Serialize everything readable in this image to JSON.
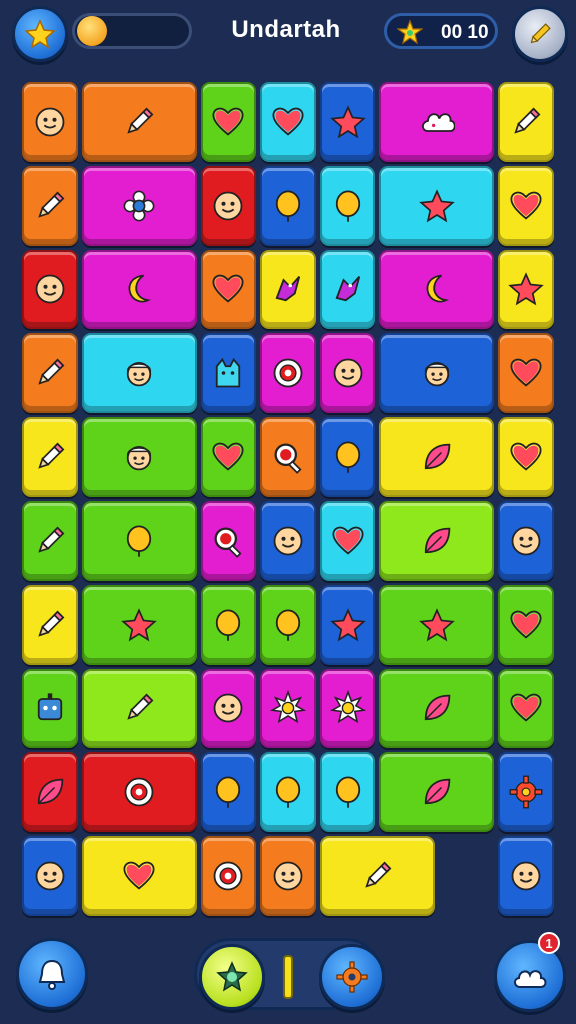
{
  "header": {
    "title": "Undartah",
    "timer": "00 10",
    "progress_fraction": 0.1,
    "left_button_icon": "star-icon",
    "right_button_icon": "pencil-icon",
    "progress_icon": "coin-flower-icon",
    "timer_icon": "star-sparkle-icon"
  },
  "footer": {
    "left_button_icon": "bell-icon",
    "center_left_icon": "star-gem-icon",
    "center_right_icon": "gear-icon",
    "right_button_icon": "cloud-icon",
    "notification_count": "1"
  },
  "colors": {
    "orange": "#f47c1e",
    "cyan": "#2fd6f0",
    "green": "#5fd21a",
    "lime": "#8fe81c",
    "blue": "#1e62d8",
    "magenta": "#e21ed0",
    "yellow": "#f7e61b",
    "red": "#e01c20"
  },
  "board": {
    "rows": 10,
    "tiles": [
      {
        "row": 0,
        "col": 0,
        "span": 1,
        "color": "orange",
        "icon": "face-icon"
      },
      {
        "row": 0,
        "col": 1,
        "span": 2,
        "color": "orange",
        "icon": "pencil-icon"
      },
      {
        "row": 0,
        "col": 3,
        "span": 1,
        "color": "green",
        "icon": "heart-icon"
      },
      {
        "row": 0,
        "col": 4,
        "span": 1,
        "color": "cyan",
        "icon": "heart-icon"
      },
      {
        "row": 0,
        "col": 5,
        "span": 1,
        "color": "blue",
        "icon": "star-icon"
      },
      {
        "row": 0,
        "col": 6,
        "span": 2,
        "color": "magenta",
        "icon": "cloud-icon"
      },
      {
        "row": 0,
        "col": 8,
        "span": 1,
        "color": "yellow",
        "icon": "pencil-icon"
      },
      {
        "row": 1,
        "col": 0,
        "span": 1,
        "color": "orange",
        "icon": "pencil-icon"
      },
      {
        "row": 1,
        "col": 1,
        "span": 2,
        "color": "magenta",
        "icon": "flower-icon"
      },
      {
        "row": 1,
        "col": 3,
        "span": 1,
        "color": "red",
        "icon": "face-icon"
      },
      {
        "row": 1,
        "col": 4,
        "span": 1,
        "color": "blue",
        "icon": "balloon-icon"
      },
      {
        "row": 1,
        "col": 5,
        "span": 1,
        "color": "cyan",
        "icon": "balloon-icon"
      },
      {
        "row": 1,
        "col": 6,
        "span": 2,
        "color": "cyan",
        "icon": "star-icon"
      },
      {
        "row": 1,
        "col": 8,
        "span": 1,
        "color": "yellow",
        "icon": "heart-icon"
      },
      {
        "row": 2,
        "col": 0,
        "span": 1,
        "color": "red",
        "icon": "face-icon"
      },
      {
        "row": 2,
        "col": 1,
        "span": 2,
        "color": "magenta",
        "icon": "moon-icon"
      },
      {
        "row": 2,
        "col": 3,
        "span": 1,
        "color": "orange",
        "icon": "heart-icon"
      },
      {
        "row": 2,
        "col": 4,
        "span": 1,
        "color": "yellow",
        "icon": "bird-icon"
      },
      {
        "row": 2,
        "col": 5,
        "span": 1,
        "color": "cyan",
        "icon": "bird-icon"
      },
      {
        "row": 2,
        "col": 6,
        "span": 2,
        "color": "magenta",
        "icon": "moon-icon"
      },
      {
        "row": 2,
        "col": 8,
        "span": 1,
        "color": "yellow",
        "icon": "star-icon"
      },
      {
        "row": 3,
        "col": 0,
        "span": 1,
        "color": "orange",
        "icon": "pencil-icon"
      },
      {
        "row": 3,
        "col": 1,
        "span": 2,
        "color": "cyan",
        "icon": "person-icon"
      },
      {
        "row": 3,
        "col": 3,
        "span": 1,
        "color": "blue",
        "icon": "cat-icon"
      },
      {
        "row": 3,
        "col": 4,
        "span": 1,
        "color": "magenta",
        "icon": "target-icon"
      },
      {
        "row": 3,
        "col": 5,
        "span": 1,
        "color": "magenta",
        "icon": "face-icon"
      },
      {
        "row": 3,
        "col": 6,
        "span": 2,
        "color": "blue",
        "icon": "person-icon"
      },
      {
        "row": 3,
        "col": 8,
        "span": 1,
        "color": "orange",
        "icon": "heart-icon"
      },
      {
        "row": 4,
        "col": 0,
        "span": 1,
        "color": "yellow",
        "icon": "pencil-icon"
      },
      {
        "row": 4,
        "col": 1,
        "span": 2,
        "color": "green",
        "icon": "person-icon"
      },
      {
        "row": 4,
        "col": 3,
        "span": 1,
        "color": "green",
        "icon": "heart-icon"
      },
      {
        "row": 4,
        "col": 4,
        "span": 1,
        "color": "orange",
        "icon": "magnifier-icon"
      },
      {
        "row": 4,
        "col": 5,
        "span": 1,
        "color": "blue",
        "icon": "balloon-icon"
      },
      {
        "row": 4,
        "col": 6,
        "span": 2,
        "color": "yellow",
        "icon": "leaf-icon"
      },
      {
        "row": 4,
        "col": 8,
        "span": 1,
        "color": "yellow",
        "icon": "heart-icon"
      },
      {
        "row": 5,
        "col": 0,
        "span": 1,
        "color": "green",
        "icon": "pencil-icon"
      },
      {
        "row": 5,
        "col": 1,
        "span": 2,
        "color": "green",
        "icon": "balloon-icon"
      },
      {
        "row": 5,
        "col": 3,
        "span": 1,
        "color": "magenta",
        "icon": "magnifier-icon"
      },
      {
        "row": 5,
        "col": 4,
        "span": 1,
        "color": "blue",
        "icon": "face-icon"
      },
      {
        "row": 5,
        "col": 5,
        "span": 1,
        "color": "cyan",
        "icon": "heart-icon"
      },
      {
        "row": 5,
        "col": 6,
        "span": 2,
        "color": "lime",
        "icon": "leaf-icon"
      },
      {
        "row": 5,
        "col": 8,
        "span": 1,
        "color": "blue",
        "icon": "face-icon"
      },
      {
        "row": 6,
        "col": 0,
        "span": 1,
        "color": "yellow",
        "icon": "pencil-icon"
      },
      {
        "row": 6,
        "col": 1,
        "span": 2,
        "color": "green",
        "icon": "star-icon"
      },
      {
        "row": 6,
        "col": 3,
        "span": 1,
        "color": "green",
        "icon": "balloon-icon"
      },
      {
        "row": 6,
        "col": 4,
        "span": 1,
        "color": "green",
        "icon": "balloon-icon"
      },
      {
        "row": 6,
        "col": 5,
        "span": 1,
        "color": "blue",
        "icon": "star-icon"
      },
      {
        "row": 6,
        "col": 6,
        "span": 2,
        "color": "green",
        "icon": "star-icon"
      },
      {
        "row": 6,
        "col": 8,
        "span": 1,
        "color": "green",
        "icon": "heart-icon"
      },
      {
        "row": 7,
        "col": 0,
        "span": 1,
        "color": "green",
        "icon": "robot-icon"
      },
      {
        "row": 7,
        "col": 1,
        "span": 2,
        "color": "lime",
        "icon": "pencil-icon"
      },
      {
        "row": 7,
        "col": 3,
        "span": 1,
        "color": "magenta",
        "icon": "face-icon"
      },
      {
        "row": 7,
        "col": 4,
        "span": 1,
        "color": "magenta",
        "icon": "sun-icon"
      },
      {
        "row": 7,
        "col": 5,
        "span": 1,
        "color": "magenta",
        "icon": "sun-icon"
      },
      {
        "row": 7,
        "col": 6,
        "span": 2,
        "color": "green",
        "icon": "leaf-icon"
      },
      {
        "row": 7,
        "col": 8,
        "span": 1,
        "color": "green",
        "icon": "heart-icon"
      },
      {
        "row": 8,
        "col": 0,
        "span": 1,
        "color": "red",
        "icon": "leaf-icon"
      },
      {
        "row": 8,
        "col": 1,
        "span": 2,
        "color": "red",
        "icon": "target-icon"
      },
      {
        "row": 8,
        "col": 3,
        "span": 1,
        "color": "blue",
        "icon": "balloon-icon"
      },
      {
        "row": 8,
        "col": 4,
        "span": 1,
        "color": "cyan",
        "icon": "balloon-icon"
      },
      {
        "row": 8,
        "col": 5,
        "span": 1,
        "color": "cyan",
        "icon": "balloon-icon"
      },
      {
        "row": 8,
        "col": 6,
        "span": 2,
        "color": "green",
        "icon": "leaf-icon"
      },
      {
        "row": 8,
        "col": 8,
        "span": 1,
        "color": "blue",
        "icon": "gear-icon"
      },
      {
        "row": 9,
        "col": 0,
        "span": 1,
        "color": "blue",
        "icon": "face-icon"
      },
      {
        "row": 9,
        "col": 1,
        "span": 2,
        "color": "yellow",
        "icon": "heart-icon"
      },
      {
        "row": 9,
        "col": 3,
        "span": 1,
        "color": "orange",
        "icon": "target-icon"
      },
      {
        "row": 9,
        "col": 4,
        "span": 1,
        "color": "orange",
        "icon": "face-icon"
      },
      {
        "row": 9,
        "col": 5,
        "span": 2,
        "color": "yellow",
        "icon": "pencil-icon"
      },
      {
        "row": 9,
        "col": 8,
        "span": 1,
        "color": "blue",
        "icon": "face-icon"
      }
    ]
  }
}
